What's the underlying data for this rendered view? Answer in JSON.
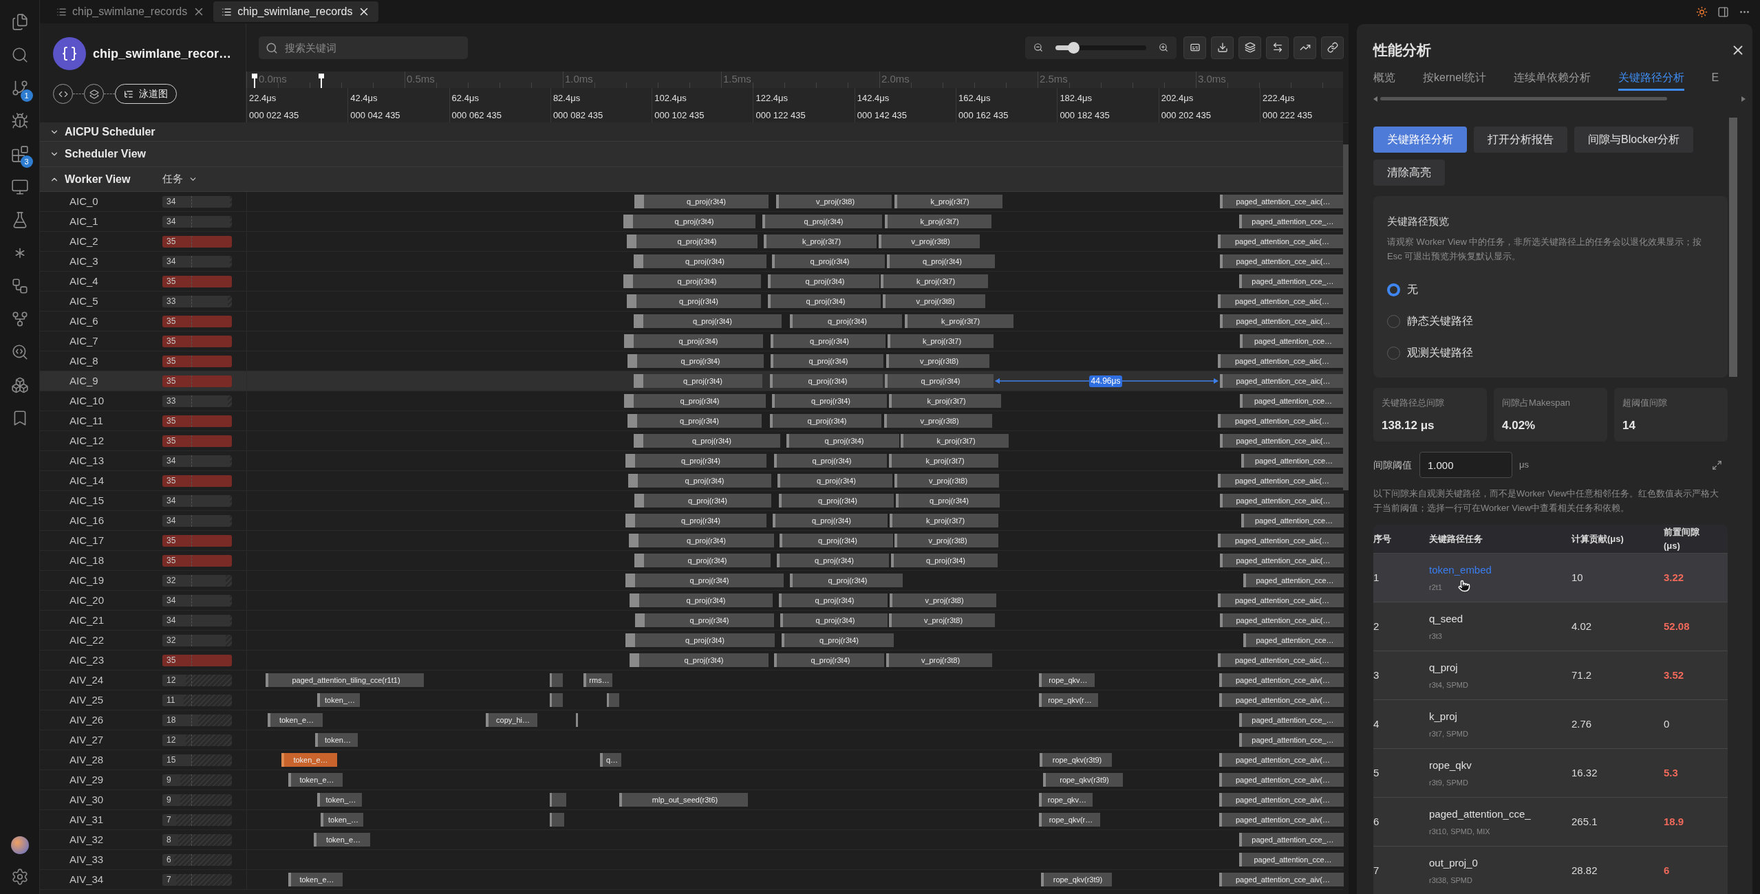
{
  "tabs": [
    {
      "label": "chip_swimlane_records",
      "selected": false
    },
    {
      "label": "chip_swimlane_records",
      "selected": true
    }
  ],
  "activity_bar": {
    "badges": [
      "1",
      "3"
    ]
  },
  "header": {
    "title": "chip_swimlane_recor…",
    "pipeline_label": "泳道图"
  },
  "search": {
    "placeholder": "搜索关键词"
  },
  "zoom": {
    "level": 0.2
  },
  "ruler": {
    "major": [
      "0.0ms",
      "0.5ms",
      "1.0ms",
      "1.5ms",
      "2.0ms",
      "2.5ms",
      "3.0ms"
    ],
    "ticks": [
      {
        "time": "22.4μs",
        "index": "000 022 435"
      },
      {
        "time": "42.4μs",
        "index": "000 042 435"
      },
      {
        "time": "62.4μs",
        "index": "000 062 435"
      },
      {
        "time": "82.4μs",
        "index": "000 082 435"
      },
      {
        "time": "102.4μs",
        "index": "000 102 435"
      },
      {
        "time": "122.4μs",
        "index": "000 122 435"
      },
      {
        "time": "142.4μs",
        "index": "000 142 435"
      },
      {
        "time": "162.4μs",
        "index": "000 162 435"
      },
      {
        "time": "182.4μs",
        "index": "000 182 435"
      },
      {
        "time": "202.4μs",
        "index": "000 202 435"
      },
      {
        "time": "222.4μs",
        "index": "000 222 435"
      }
    ]
  },
  "groups": [
    {
      "label": "AICPU Scheduler",
      "expanded": false
    },
    {
      "label": "Scheduler View",
      "expanded": false
    },
    {
      "label": "Worker View",
      "expanded": true,
      "filter": "任务"
    }
  ],
  "workers": [
    {
      "name": "AIC_0",
      "count": "34",
      "level": 0.97,
      "flagged": false,
      "selected": false,
      "tasks": [
        {
          "kind": "task",
          "label": "q_proj(r3t4)",
          "highlighted": false
        },
        {
          "kind": "task",
          "label": "v_proj(r3t8)",
          "highlighted": false
        },
        {
          "kind": "task",
          "label": "k_proj(r3t7)",
          "highlighted": false
        },
        {
          "kind": "task",
          "label": "paged_attention_cce_aic(…",
          "highlighted": false
        }
      ]
    },
    {
      "name": "AIC_1",
      "count": "34",
      "level": 0.97,
      "flagged": false,
      "selected": false,
      "tasks": [
        {
          "kind": "task",
          "label": "q_proj(r3t4)",
          "highlighted": false
        },
        {
          "kind": "task",
          "label": "q_proj(r3t4)",
          "highlighted": false
        },
        {
          "kind": "task",
          "label": "k_proj(r3t7)",
          "highlighted": false
        },
        {
          "kind": "task",
          "label": "paged_attention_cce_…",
          "highlighted": false
        }
      ]
    },
    {
      "name": "AIC_2",
      "count": "35",
      "level": 1,
      "flagged": true,
      "selected": false,
      "tasks": [
        {
          "kind": "task",
          "label": "q_proj(r3t4)",
          "highlighted": false
        },
        {
          "kind": "task",
          "label": "k_proj(r3t7)",
          "highlighted": false
        },
        {
          "kind": "task",
          "label": "v_proj(r3t8)",
          "highlighted": false
        },
        {
          "kind": "task",
          "label": "paged_attention_cce_aic(…",
          "highlighted": false
        }
      ]
    },
    {
      "name": "AIC_3",
      "count": "34",
      "level": 0.97,
      "flagged": false,
      "selected": false,
      "tasks": [
        {
          "kind": "task",
          "label": "q_proj(r3t4)",
          "highlighted": false
        },
        {
          "kind": "task",
          "label": "q_proj(r3t4)",
          "highlighted": false
        },
        {
          "kind": "task",
          "label": "q_proj(r3t4)",
          "highlighted": false
        },
        {
          "kind": "task",
          "label": "paged_attention_cce_aic(…",
          "highlighted": false
        }
      ]
    },
    {
      "name": "AIC_4",
      "count": "35",
      "level": 1,
      "flagged": true,
      "selected": false,
      "tasks": [
        {
          "kind": "task",
          "label": "q_proj(r3t4)",
          "highlighted": false
        },
        {
          "kind": "task",
          "label": "q_proj(r3t4)",
          "highlighted": false
        },
        {
          "kind": "task",
          "label": "k_proj(r3t7)",
          "highlighted": false
        },
        {
          "kind": "task",
          "label": "paged_attention_cce_…",
          "highlighted": false
        }
      ]
    },
    {
      "name": "AIC_5",
      "count": "33",
      "level": 0.94,
      "flagged": false,
      "selected": false,
      "tasks": [
        {
          "kind": "task",
          "label": "q_proj(r3t4)",
          "highlighted": false
        },
        {
          "kind": "task",
          "label": "q_proj(r3t4)",
          "highlighted": false
        },
        {
          "kind": "task",
          "label": "v_proj(r3t8)",
          "highlighted": false
        },
        {
          "kind": "task",
          "label": "paged_attention_cce_aic(…",
          "highlighted": false
        }
      ]
    },
    {
      "name": "AIC_6",
      "count": "35",
      "level": 1,
      "flagged": true,
      "selected": false,
      "tasks": [
        {
          "kind": "task",
          "label": "q_proj(r3t4)",
          "highlighted": false
        },
        {
          "kind": "task",
          "label": "q_proj(r3t4)",
          "highlighted": false
        },
        {
          "kind": "task",
          "label": "k_proj(r3t7)",
          "highlighted": false
        },
        {
          "kind": "task",
          "label": "paged_attention_cce_aic(…",
          "highlighted": false
        }
      ]
    },
    {
      "name": "AIC_7",
      "count": "35",
      "level": 1,
      "flagged": true,
      "selected": false,
      "tasks": [
        {
          "kind": "task",
          "label": "q_proj(r3t4)",
          "highlighted": false
        },
        {
          "kind": "task",
          "label": "q_proj(r3t4)",
          "highlighted": false
        },
        {
          "kind": "task",
          "label": "k_proj(r3t7)",
          "highlighted": false
        },
        {
          "kind": "task",
          "label": "paged_attention_cce…",
          "highlighted": false
        }
      ]
    },
    {
      "name": "AIC_8",
      "count": "35",
      "level": 1,
      "flagged": true,
      "selected": false,
      "tasks": [
        {
          "kind": "task",
          "label": "q_proj(r3t4)",
          "highlighted": false
        },
        {
          "kind": "task",
          "label": "q_proj(r3t4)",
          "highlighted": false
        },
        {
          "kind": "task",
          "label": "v_proj(r3t8)",
          "highlighted": false
        },
        {
          "kind": "task",
          "label": "paged_attention_cce_aic(…",
          "highlighted": false
        }
      ]
    },
    {
      "name": "AIC_9",
      "count": "35",
      "level": 1,
      "flagged": true,
      "selected": true,
      "gap": "44.96μs",
      "tasks": [
        {
          "kind": "task",
          "label": "q_proj(r3t4)",
          "highlighted": false
        },
        {
          "kind": "task",
          "label": "q_proj(r3t4)",
          "highlighted": false
        },
        {
          "kind": "task",
          "label": "q_proj(r3t4)",
          "highlighted": false
        },
        {
          "kind": "task",
          "label": "paged_attention_cce_aic(…",
          "highlighted": false
        }
      ]
    },
    {
      "name": "AIC_10",
      "count": "33",
      "level": 0.94,
      "flagged": false,
      "selected": false,
      "tasks": [
        {
          "kind": "task",
          "label": "q_proj(r3t4)",
          "highlighted": false
        },
        {
          "kind": "task",
          "label": "q_proj(r3t4)",
          "highlighted": false
        },
        {
          "kind": "task",
          "label": "k_proj(r3t7)",
          "highlighted": false
        },
        {
          "kind": "task",
          "label": "paged_attention_cce…",
          "highlighted": false
        }
      ]
    },
    {
      "name": "AIC_11",
      "count": "35",
      "level": 1,
      "flagged": true,
      "selected": false,
      "tasks": [
        {
          "kind": "task",
          "label": "q_proj(r3t4)",
          "highlighted": false
        },
        {
          "kind": "task",
          "label": "q_proj(r3t4)",
          "highlighted": false
        },
        {
          "kind": "task",
          "label": "v_proj(r3t8)",
          "highlighted": false
        },
        {
          "kind": "task",
          "label": "paged_attention_cce_aic(…",
          "highlighted": false
        }
      ]
    },
    {
      "name": "AIC_12",
      "count": "35",
      "level": 1,
      "flagged": true,
      "selected": false,
      "tasks": [
        {
          "kind": "task",
          "label": "q_proj(r3t4)",
          "highlighted": false
        },
        {
          "kind": "task",
          "label": "q_proj(r3t4)",
          "highlighted": false
        },
        {
          "kind": "task",
          "label": "k_proj(r3t7)",
          "highlighted": false
        },
        {
          "kind": "task",
          "label": "paged_attention_cce_aic(…",
          "highlighted": false
        }
      ]
    },
    {
      "name": "AIC_13",
      "count": "34",
      "level": 0.97,
      "flagged": false,
      "selected": false,
      "tasks": [
        {
          "kind": "task",
          "label": "q_proj(r3t4)",
          "highlighted": false
        },
        {
          "kind": "task",
          "label": "q_proj(r3t4)",
          "highlighted": false
        },
        {
          "kind": "task",
          "label": "k_proj(r3t7)",
          "highlighted": false
        },
        {
          "kind": "task",
          "label": "paged_attention_cce…",
          "highlighted": false
        }
      ]
    },
    {
      "name": "AIC_14",
      "count": "35",
      "level": 1,
      "flagged": true,
      "selected": false,
      "tasks": [
        {
          "kind": "task",
          "label": "q_proj(r3t4)",
          "highlighted": false
        },
        {
          "kind": "task",
          "label": "q_proj(r3t4)",
          "highlighted": false
        },
        {
          "kind": "task",
          "label": "v_proj(r3t8)",
          "highlighted": false
        },
        {
          "kind": "task",
          "label": "paged_attention_cce_aic(…",
          "highlighted": false
        }
      ]
    },
    {
      "name": "AIC_15",
      "count": "34",
      "level": 0.97,
      "flagged": false,
      "selected": false,
      "tasks": [
        {
          "kind": "task",
          "label": "q_proj(r3t4)",
          "highlighted": false
        },
        {
          "kind": "task",
          "label": "q_proj(r3t4)",
          "highlighted": false
        },
        {
          "kind": "task",
          "label": "q_proj(r3t4)",
          "highlighted": false
        },
        {
          "kind": "task",
          "label": "paged_attention_cce_aic(…",
          "highlighted": false
        }
      ]
    },
    {
      "name": "AIC_16",
      "count": "34",
      "level": 0.97,
      "flagged": false,
      "selected": false,
      "tasks": [
        {
          "kind": "task",
          "label": "q_proj(r3t4)",
          "highlighted": false
        },
        {
          "kind": "task",
          "label": "q_proj(r3t4)",
          "highlighted": false
        },
        {
          "kind": "task",
          "label": "k_proj(r3t7)",
          "highlighted": false
        },
        {
          "kind": "task",
          "label": "paged_attention_cce…",
          "highlighted": false
        }
      ]
    },
    {
      "name": "AIC_17",
      "count": "35",
      "level": 1,
      "flagged": true,
      "selected": false,
      "tasks": [
        {
          "kind": "task",
          "label": "q_proj(r3t4)",
          "highlighted": false
        },
        {
          "kind": "task",
          "label": "q_proj(r3t4)",
          "highlighted": false
        },
        {
          "kind": "task",
          "label": "v_proj(r3t8)",
          "highlighted": false
        },
        {
          "kind": "task",
          "label": "paged_attention_cce_aic(…",
          "highlighted": false
        }
      ]
    },
    {
      "name": "AIC_18",
      "count": "35",
      "level": 1,
      "flagged": true,
      "selected": false,
      "tasks": [
        {
          "kind": "task",
          "label": "q_proj(r3t4)",
          "highlighted": false
        },
        {
          "kind": "task",
          "label": "q_proj(r3t4)",
          "highlighted": false
        },
        {
          "kind": "task",
          "label": "q_proj(r3t4)",
          "highlighted": false
        },
        {
          "kind": "task",
          "label": "paged_attention_cce_aic(…",
          "highlighted": false
        }
      ]
    },
    {
      "name": "AIC_19",
      "count": "32",
      "level": 0.91,
      "flagged": false,
      "selected": false,
      "tasks": [
        {
          "kind": "task",
          "label": "q_proj(r3t4)",
          "highlighted": false
        },
        {
          "kind": "task",
          "label": "q_proj(r3t4)",
          "highlighted": false
        },
        {
          "kind": "task",
          "label": "paged_attention_cce…",
          "highlighted": false
        }
      ]
    },
    {
      "name": "AIC_20",
      "count": "34",
      "level": 0.97,
      "flagged": false,
      "selected": false,
      "tasks": [
        {
          "kind": "task",
          "label": "q_proj(r3t4)",
          "highlighted": false
        },
        {
          "kind": "task",
          "label": "q_proj(r3t4)",
          "highlighted": false
        },
        {
          "kind": "task",
          "label": "v_proj(r3t8)",
          "highlighted": false
        },
        {
          "kind": "task",
          "label": "paged_attention_cce_aic(…",
          "highlighted": false
        }
      ]
    },
    {
      "name": "AIC_21",
      "count": "34",
      "level": 0.97,
      "flagged": false,
      "selected": false,
      "tasks": [
        {
          "kind": "task",
          "label": "q_proj(r3t4)",
          "highlighted": false
        },
        {
          "kind": "task",
          "label": "q_proj(r3t4)",
          "highlighted": false
        },
        {
          "kind": "task",
          "label": "v_proj(r3t8)",
          "highlighted": false
        },
        {
          "kind": "task",
          "label": "paged_attention_cce_aic(…",
          "highlighted": false
        }
      ]
    },
    {
      "name": "AIC_22",
      "count": "32",
      "level": 0.91,
      "flagged": false,
      "selected": false,
      "tasks": [
        {
          "kind": "task",
          "label": "q_proj(r3t4)",
          "highlighted": false
        },
        {
          "kind": "task",
          "label": "q_proj(r3t4)",
          "highlighted": false
        },
        {
          "kind": "task",
          "label": "paged_attention_cce…",
          "highlighted": false
        }
      ]
    },
    {
      "name": "AIC_23",
      "count": "35",
      "level": 1,
      "flagged": true,
      "selected": false,
      "tasks": [
        {
          "kind": "task",
          "label": "q_proj(r3t4)",
          "highlighted": false
        },
        {
          "kind": "task",
          "label": "q_proj(r3t4)",
          "highlighted": false
        },
        {
          "kind": "task",
          "label": "v_proj(r3t8)",
          "highlighted": false
        },
        {
          "kind": "task",
          "label": "paged_attention_cce_aic(…",
          "highlighted": false
        }
      ]
    },
    {
      "name": "AIV_24",
      "count": "12",
      "level": 0.34,
      "flagged": false,
      "selected": false,
      "tasks": [
        {
          "kind": "task",
          "label": "paged_attention_tiling_cce(r1t1)",
          "highlighted": false
        },
        {
          "kind": "blip",
          "highlighted": false
        },
        {
          "kind": "task",
          "label": "rms…",
          "highlighted": false
        },
        {
          "kind": "task",
          "label": "rope_qkv…",
          "highlighted": false
        },
        {
          "kind": "task",
          "label": "paged_attention_cce_aiv(…",
          "highlighted": false
        }
      ]
    },
    {
      "name": "AIV_25",
      "count": "11",
      "level": 0.31,
      "flagged": false,
      "selected": false,
      "tasks": [
        {
          "kind": "task",
          "label": "token_…",
          "highlighted": false
        },
        {
          "kind": "blip",
          "highlighted": false
        },
        {
          "kind": "blip",
          "highlighted": false
        },
        {
          "kind": "task",
          "label": "rope_qkv(r…",
          "highlighted": false
        },
        {
          "kind": "task",
          "label": "paged_attention_cce_aiv(…",
          "highlighted": false
        }
      ]
    },
    {
      "name": "AIV_26",
      "count": "18",
      "level": 0.51,
      "flagged": false,
      "selected": false,
      "tasks": [
        {
          "kind": "task",
          "label": "token_e…",
          "highlighted": false
        },
        {
          "kind": "task",
          "label": "copy_hi…",
          "highlighted": false
        },
        {
          "kind": "blip",
          "highlighted": false
        },
        {
          "kind": "task",
          "label": "paged_attention_cce_…",
          "highlighted": false
        }
      ]
    },
    {
      "name": "AIV_27",
      "count": "12",
      "level": 0.34,
      "flagged": false,
      "selected": false,
      "tasks": [
        {
          "kind": "task",
          "label": "token…",
          "highlighted": false
        },
        {
          "kind": "task",
          "label": "paged_attention_cce_…",
          "highlighted": false
        }
      ]
    },
    {
      "name": "AIV_28",
      "count": "15",
      "level": 0.43,
      "flagged": false,
      "selected": false,
      "tasks": [
        {
          "kind": "task",
          "label": "token_e…",
          "highlighted": true
        },
        {
          "kind": "task",
          "label": "q…",
          "highlighted": false
        },
        {
          "kind": "task",
          "label": "rope_qkv(r3t9)",
          "highlighted": false
        },
        {
          "kind": "task",
          "label": "paged_attention_cce_aiv(…",
          "highlighted": false
        }
      ]
    },
    {
      "name": "AIV_29",
      "count": "9",
      "level": 0.26,
      "flagged": false,
      "selected": false,
      "tasks": [
        {
          "kind": "task",
          "label": "token_e…",
          "highlighted": false
        },
        {
          "kind": "task",
          "label": "rope_qkv(r3t9)",
          "highlighted": false
        },
        {
          "kind": "task",
          "label": "paged_attention_cce_aiv(…",
          "highlighted": false
        }
      ]
    },
    {
      "name": "AIV_30",
      "count": "9",
      "level": 0.26,
      "flagged": false,
      "selected": false,
      "tasks": [
        {
          "kind": "task",
          "label": "token_…",
          "highlighted": false
        },
        {
          "kind": "blip",
          "highlighted": false
        },
        {
          "kind": "task",
          "label": "mlp_out_seed(r3t6)",
          "highlighted": false
        },
        {
          "kind": "task",
          "label": "rope_qkv…",
          "highlighted": false
        },
        {
          "kind": "task",
          "label": "paged_attention_cce_aiv(…",
          "highlighted": false
        }
      ]
    },
    {
      "name": "AIV_31",
      "count": "7",
      "level": 0.2,
      "flagged": false,
      "selected": false,
      "tasks": [
        {
          "kind": "task",
          "label": "token_…",
          "highlighted": false
        },
        {
          "kind": "blip",
          "highlighted": false
        },
        {
          "kind": "task",
          "label": "rope_qkv(r…",
          "highlighted": false
        },
        {
          "kind": "task",
          "label": "paged_attention_cce_aiv(…",
          "highlighted": false
        }
      ]
    },
    {
      "name": "AIV_32",
      "count": "8",
      "level": 0.23,
      "flagged": false,
      "selected": false,
      "tasks": [
        {
          "kind": "task",
          "label": "token_e…",
          "highlighted": false
        },
        {
          "kind": "task",
          "label": "paged_attention_cce_…",
          "highlighted": false
        }
      ]
    },
    {
      "name": "AIV_33",
      "count": "6",
      "level": 0.17,
      "flagged": false,
      "selected": false,
      "tasks": [
        {
          "kind": "task",
          "label": "paged_attention_cce…",
          "highlighted": false
        }
      ]
    },
    {
      "name": "AIV_34",
      "count": "7",
      "level": 0.2,
      "flagged": false,
      "selected": false,
      "tasks": [
        {
          "kind": "task",
          "label": "token_e…",
          "highlighted": false
        },
        {
          "kind": "task",
          "label": "rope_qkv(r3t9)",
          "highlighted": false
        },
        {
          "kind": "task",
          "label": "paged_attention_cce_aiv(…",
          "highlighted": false
        }
      ]
    }
  ],
  "panel": {
    "title": "性能分析",
    "tabs": [
      {
        "label": "概览",
        "selected": false
      },
      {
        "label": "按kernel统计",
        "selected": false
      },
      {
        "label": "连续单依赖分析",
        "selected": false
      },
      {
        "label": "关键路径分析",
        "selected": true
      },
      {
        "label": "E",
        "selected": false
      }
    ],
    "actions": [
      {
        "label": "关键路径分析",
        "primary": true
      },
      {
        "label": "打开分析报告",
        "primary": false
      },
      {
        "label": "间隙与Blocker分析",
        "primary": false
      },
      {
        "label": "清除高亮",
        "primary": false
      }
    ],
    "preview": {
      "title": "关键路径预览",
      "description": "请观察 Worker View 中的任务，非所选关键路径上的任务会以退化效果显示；按 Esc 可退出预览并恢复默认显示。",
      "options": [
        {
          "label": "无",
          "selected": true
        },
        {
          "label": "静态关键路径",
          "selected": false
        },
        {
          "label": "观测关键路径",
          "selected": false
        }
      ]
    },
    "stats": [
      {
        "label": "关键路径总间隙",
        "value": "138.12 μs"
      },
      {
        "label": "间隙占Makespan",
        "value": "4.02%"
      },
      {
        "label": "超阈值间隙",
        "value": "14"
      }
    ],
    "threshold": {
      "label": "间隙阈值",
      "value": "1.000",
      "unit": "μs"
    },
    "note": "以下间隙来自观测关键路径，而不是Worker View中任意相邻任务。红色数值表示严格大于当前阈值；选择一行可在Worker View中查看相关任务和依赖。",
    "table": {
      "columns": [
        "序号",
        "关键路径任务",
        "计算贡献(μs)",
        "前置间隙 (μs)"
      ],
      "rows": [
        {
          "index": "1",
          "task": "token_embed",
          "meta": "r2t1",
          "compute": "10",
          "gap": "3.22",
          "over": true,
          "selected": true
        },
        {
          "index": "2",
          "task": "q_seed",
          "meta": "r3t3",
          "compute": "4.02",
          "gap": "52.08",
          "over": true,
          "selected": false
        },
        {
          "index": "3",
          "task": "q_proj",
          "meta": "r3t4, SPMD",
          "compute": "71.2",
          "gap": "3.52",
          "over": true,
          "selected": false
        },
        {
          "index": "4",
          "task": "k_proj",
          "meta": "r3t7, SPMD",
          "compute": "2.76",
          "gap": "0",
          "over": false,
          "selected": false
        },
        {
          "index": "5",
          "task": "rope_qkv",
          "meta": "r3t9, SPMD",
          "compute": "16.32",
          "gap": "5.3",
          "over": true,
          "selected": false
        },
        {
          "index": "6",
          "task": "paged_attention_cce_",
          "meta": "r3t10, SPMD, MIX",
          "compute": "265.1",
          "gap": "18.9",
          "over": true,
          "selected": false
        },
        {
          "index": "7",
          "task": "out_proj_0",
          "meta": "r3t38, SPMD",
          "compute": "28.82",
          "gap": "6",
          "over": true,
          "selected": false
        }
      ]
    }
  }
}
